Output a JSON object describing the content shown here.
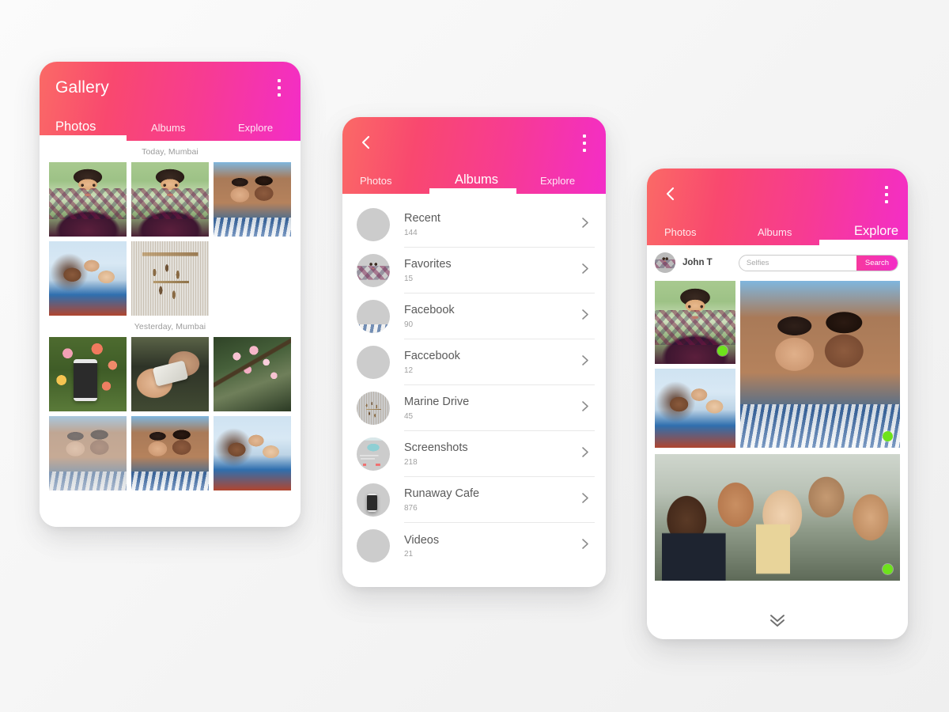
{
  "theme": {
    "gradient_start": "#fa6a66",
    "gradient_end": "#f32dc8",
    "accent_green": "#6ee21c",
    "background": "#f7f7f7"
  },
  "phone_photos": {
    "app_title": "Gallery",
    "overflow_icon": "overflow-menu-icon",
    "tabs": [
      {
        "label": "Photos",
        "active": true
      },
      {
        "label": "Albums",
        "active": false
      },
      {
        "label": "Explore",
        "active": false
      }
    ],
    "sections": [
      {
        "label": "Today, Mumbai",
        "photos": [
          {
            "alt": "man-plaid-selfie"
          },
          {
            "alt": "man-plaid-selfie-2"
          },
          {
            "alt": "couple-red-rock"
          },
          {
            "alt": "three-friends-selfie"
          },
          {
            "alt": "wind-chime"
          }
        ]
      },
      {
        "label": "Yesterday, Mumbai",
        "photos": [
          {
            "alt": "flowers-phone"
          },
          {
            "alt": "hands-phone"
          },
          {
            "alt": "cherry-blossom"
          },
          {
            "alt": "couple-red-rock-faded"
          },
          {
            "alt": "couple-red-rock-2"
          },
          {
            "alt": "group-selfie"
          }
        ]
      }
    ]
  },
  "phone_albums": {
    "back_icon": "back-chevron-icon",
    "overflow_icon": "overflow-menu-icon",
    "tabs": [
      {
        "label": "Photos",
        "active": false
      },
      {
        "label": "Albums",
        "active": true
      },
      {
        "label": "Explore",
        "active": false
      }
    ],
    "albums": [
      {
        "name": "Recent",
        "count": "144",
        "thumb": "blossom-branch"
      },
      {
        "name": "Favorites",
        "count": "15",
        "thumb": "man-plaid-selfie"
      },
      {
        "name": "Facebook",
        "count": "90",
        "thumb": "couple-red-rock"
      },
      {
        "name": "Faccebook",
        "count": "12",
        "thumb": "group-selfie"
      },
      {
        "name": "Marine Drive",
        "count": "45",
        "thumb": "wind-chime"
      },
      {
        "name": "Screenshots",
        "count": "218",
        "thumb": "app-screenshot"
      },
      {
        "name": "Runaway Cafe",
        "count": "876",
        "thumb": "flowers-phone"
      },
      {
        "name": "Videos",
        "count": "21",
        "thumb": "hands-phone-dark"
      }
    ],
    "row_chevron_icon": "chevron-right-icon"
  },
  "phone_explore": {
    "back_icon": "back-chevron-icon",
    "overflow_icon": "overflow-menu-icon",
    "tabs": [
      {
        "label": "Photos",
        "active": false
      },
      {
        "label": "Albums",
        "active": false
      },
      {
        "label": "Explore",
        "active": true
      }
    ],
    "user": {
      "name": "John T",
      "avatar": "user-avatar"
    },
    "search": {
      "placeholder": "Selfies",
      "value": "",
      "button_label": "Search"
    },
    "results": [
      {
        "alt": "man-plaid-selfie",
        "badge": true
      },
      {
        "alt": "three-friends-selfie",
        "badge": false
      },
      {
        "alt": "couple-red-rock",
        "badge": true
      },
      {
        "alt": "group-selfie-five",
        "badge": true
      }
    ],
    "load_more_icon": "double-chevron-down-icon"
  }
}
